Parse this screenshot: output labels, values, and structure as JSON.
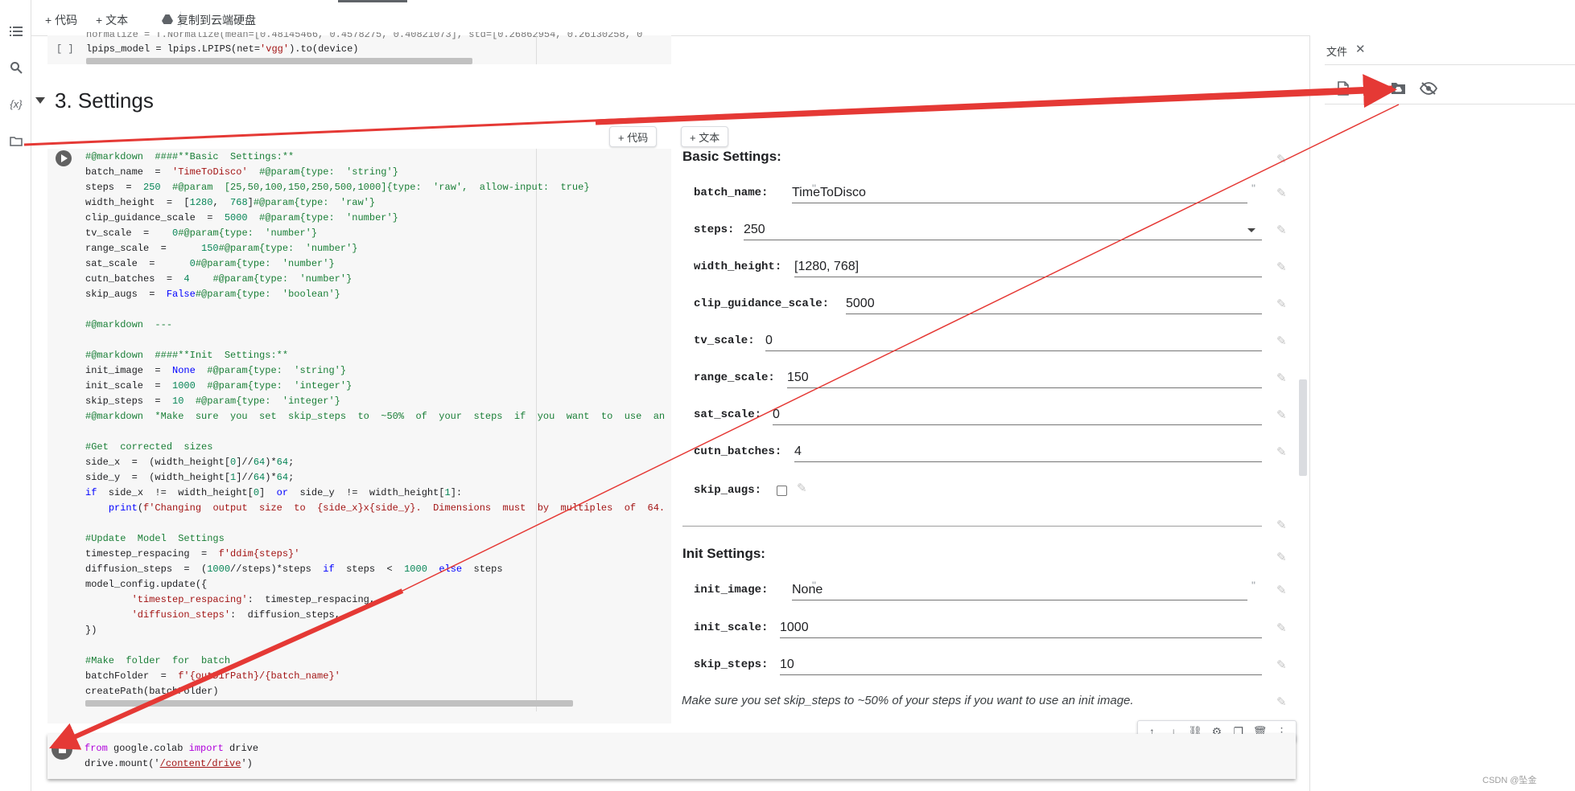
{
  "toolbar": {
    "add_code": "+ 代码",
    "add_text": "+ 文本",
    "copy_drive": "复制到云端硬盘"
  },
  "prev_cell": {
    "line1": "normalize = T.Normalize(mean=[0.48145466, 0.4578275, 0.40821073], std=[0.26862954, 0.26130258, 0",
    "bracket": "[ ]",
    "line2_a": "lpips_model = lpips.LPIPS(net=",
    "line2_str": "'vgg'",
    "line2_b": ").to(device)"
  },
  "section": {
    "title": "3. Settings"
  },
  "hover_buttons": {
    "code": "+ 代码",
    "text": "+ 文本"
  },
  "form": {
    "basic_heading": "Basic Settings:",
    "init_heading": "Init Settings:",
    "note": "Make sure you set skip_steps to ~50% of your steps if you want to use an init image.",
    "fields": [
      {
        "label": "batch_name:",
        "value": "TimeToDisco"
      },
      {
        "label": "steps:",
        "value": "250"
      },
      {
        "label": "width_height:",
        "value": "[1280, 768]"
      },
      {
        "label": "clip_guidance_scale:",
        "value": "5000"
      },
      {
        "label": "tv_scale:",
        "value": "0"
      },
      {
        "label": "range_scale:",
        "value": "150"
      },
      {
        "label": "sat_scale:",
        "value": "0"
      },
      {
        "label": "cutn_batches:",
        "value": "4"
      },
      {
        "label": "skip_augs:",
        "value": ""
      },
      {
        "label": "init_image:",
        "value": "None"
      },
      {
        "label": "init_scale:",
        "value": "1000"
      },
      {
        "label": "skip_steps:",
        "value": "10"
      }
    ]
  },
  "right_panel": {
    "tab": "文件"
  },
  "drive_cell": {
    "line1_kw1": "from",
    "line1_mid": " google.colab ",
    "line1_kw2": "import",
    "line1_end": " drive",
    "line2_a": "drive.mount('",
    "line2_link": "/content/drive",
    "line2_b": "')"
  },
  "watermark": "CSDN @坠金",
  "colors": {
    "annotation_arrow": "#e53935",
    "run_button": "#616161",
    "cell_bg": "#f7f7f7"
  },
  "icons": [
    "toc-icon",
    "search-icon",
    "variables-icon",
    "folder-icon",
    "drive-icon",
    "run-icon",
    "stop-icon",
    "pencil-icon",
    "close-icon",
    "new-file-icon",
    "upload-icon",
    "mount-drive-icon",
    "hidden-files-icon"
  ]
}
